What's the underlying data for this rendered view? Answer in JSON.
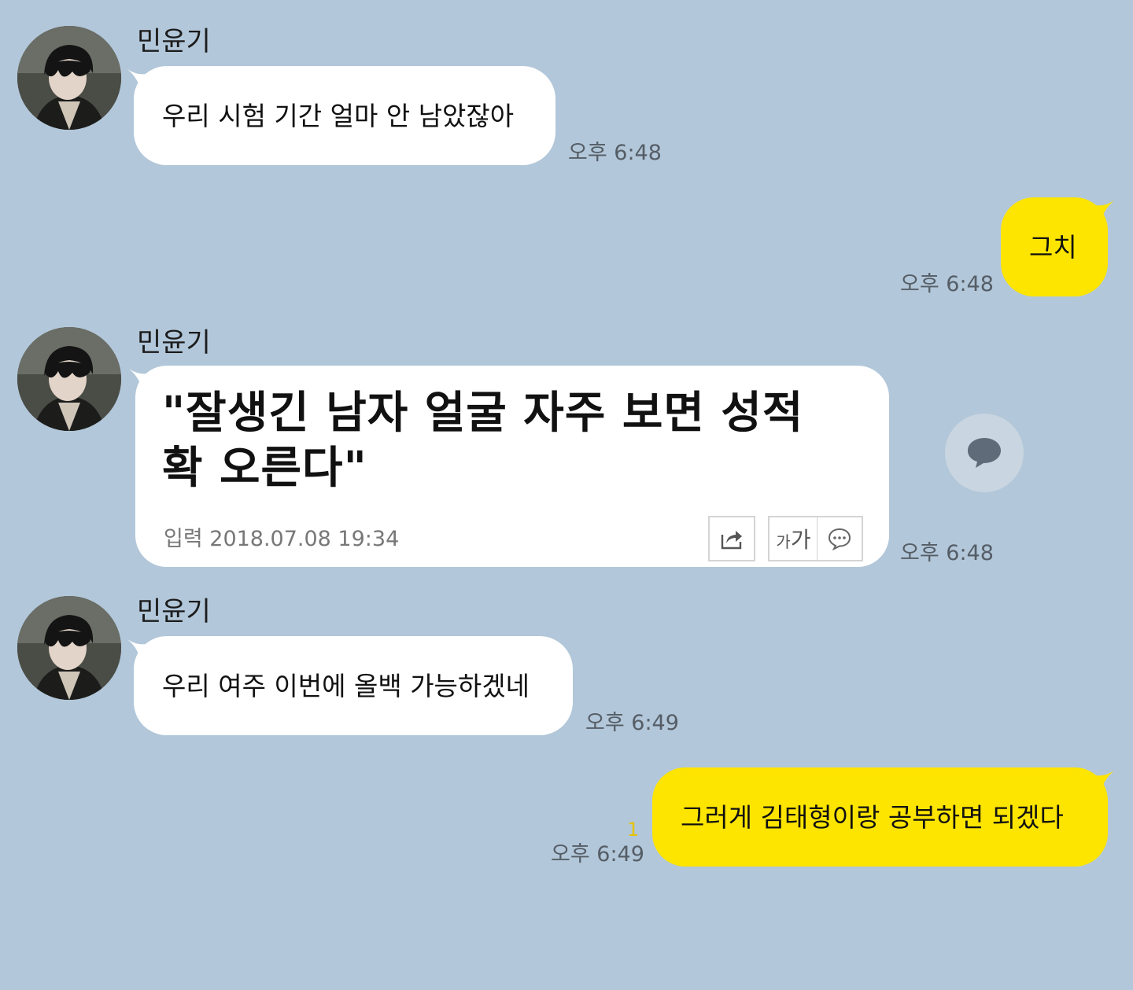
{
  "chat": {
    "sender_name": "민윤기",
    "messages": [
      {
        "from": "other",
        "text": "우리 시험 기간 얼마 안 남았잖아",
        "time": "오후 6:48"
      },
      {
        "from": "me",
        "text": "그치",
        "time": "오후 6:48"
      },
      {
        "from": "other",
        "type": "news_card",
        "headline": "\"잘생긴 남자 얼굴 자주 보면 성적 확 오른다\"",
        "dateline": "입력 2018.07.08 19:34",
        "font_size_small": "가",
        "font_size_large": "가",
        "time": "오후 6:48"
      },
      {
        "from": "other",
        "text": "우리 여주 이번에 올백 가능하겠네",
        "time": "오후 6:49"
      },
      {
        "from": "me",
        "text": "그러게 김태형이랑 공부하면 되겠다",
        "time": "오후 6:49",
        "unread_count": "1"
      }
    ]
  },
  "icons": {
    "share": "share-icon",
    "font_size": "font-size-icon",
    "comment": "comment-icon",
    "comment_fab": "chat-bubble-icon"
  },
  "colors": {
    "background": "#b2c7d9",
    "my_bubble": "#fee500",
    "other_bubble": "#ffffff",
    "unread": "#e6c200"
  }
}
